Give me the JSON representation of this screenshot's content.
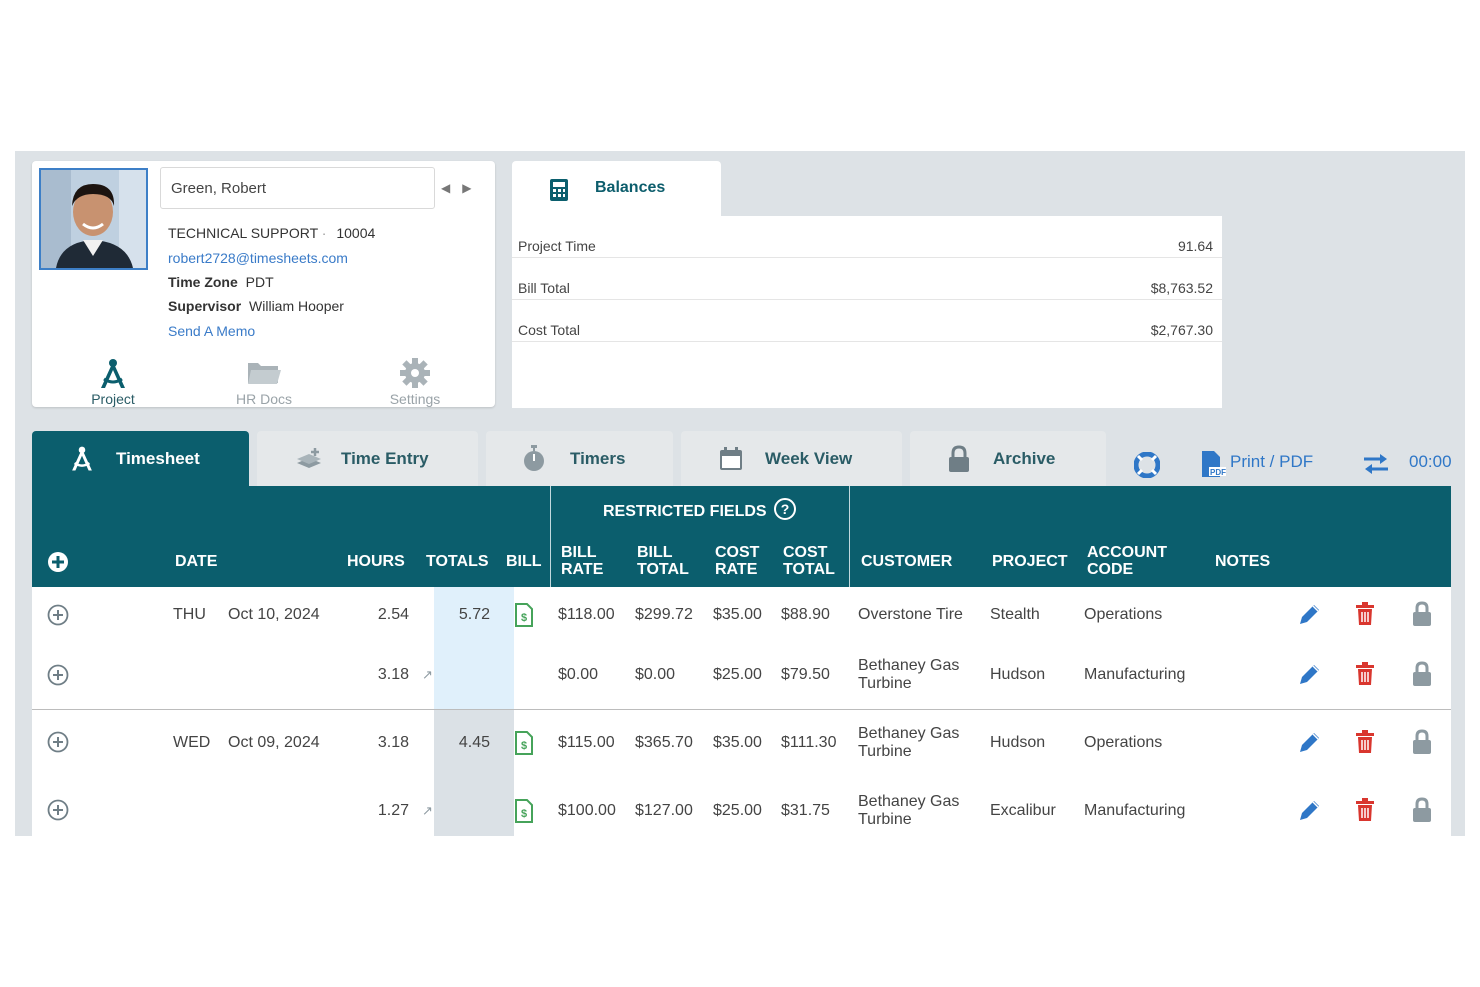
{
  "colors": {
    "primary": "#0b5e6d",
    "link": "#3a7bc8",
    "edit": "#2f77c7",
    "delete": "#d9362e",
    "lock": "#8d9aa1",
    "bill_icon": "#46a35a"
  },
  "profile": {
    "name": "Green, Robert",
    "department": "TECHNICAL SUPPORT",
    "separator": "·",
    "employee_id": "10004",
    "email": "robert2728@timesheets.com",
    "timezone_label": "Time Zone",
    "timezone": "PDT",
    "supervisor_label": "Supervisor",
    "supervisor": "William Hooper",
    "memo_link": "Send A Memo",
    "tabs": [
      {
        "label": "Project",
        "icon": "compass-icon"
      },
      {
        "label": "HR Docs",
        "icon": "folder-icon"
      },
      {
        "label": "Settings",
        "icon": "gear-icon"
      }
    ]
  },
  "balances": {
    "title": "Balances",
    "icon": "calculator-icon",
    "rows": [
      {
        "label": "Project Time",
        "value": "91.64"
      },
      {
        "label": "Bill Total",
        "value": "$8,763.52"
      },
      {
        "label": "Cost Total",
        "value": "$2,767.30"
      }
    ]
  },
  "tabs": [
    {
      "label": "Timesheet",
      "icon": "compass-icon",
      "active": true
    },
    {
      "label": "Time Entry",
      "icon": "stack-add-icon"
    },
    {
      "label": "Timers",
      "icon": "stopwatch-icon"
    },
    {
      "label": "Week View",
      "icon": "calendar-icon"
    },
    {
      "label": "Archive",
      "icon": "lock-icon"
    }
  ],
  "toolbar": {
    "help_icon": "lifebuoy-icon",
    "print_label": "Print / PDF",
    "timer_value": "00:00"
  },
  "table": {
    "restricted_label": "RESTRICTED FIELDS",
    "headers": {
      "date": "DATE",
      "hours": "HOURS",
      "totals": "TOTALS",
      "bill": "BILL",
      "bill_rate_1": "BILL",
      "bill_rate_2": "RATE",
      "bill_total_1": "BILL",
      "bill_total_2": "TOTAL",
      "cost_rate_1": "COST",
      "cost_rate_2": "RATE",
      "cost_total_1": "COST",
      "cost_total_2": "TOTAL",
      "customer": "CUSTOMER",
      "project": "PROJECT",
      "account_1": "ACCOUNT",
      "account_2": "CODE",
      "notes": "NOTES"
    },
    "rows": [
      {
        "day": "THU",
        "date": "Oct 10, 2024",
        "hours": "2.54",
        "total": "5.72",
        "billable": true,
        "bill_rate": "$118.00",
        "bill_total": "$299.72",
        "cost_rate": "$35.00",
        "cost_total": "$88.90",
        "customer_1": "Overstone Tire",
        "customer_2": "",
        "project": "Stealth",
        "account": "Operations"
      },
      {
        "day": "",
        "date": "",
        "hours": "3.18",
        "total": "",
        "billable": false,
        "bill_rate": "$0.00",
        "bill_total": "$0.00",
        "cost_rate": "$25.00",
        "cost_total": "$79.50",
        "customer_1": "Bethaney Gas",
        "customer_2": "Turbine",
        "project": "Hudson",
        "account": "Manufacturing"
      },
      {
        "day": "WED",
        "date": "Oct 09, 2024",
        "hours": "3.18",
        "total": "4.45",
        "billable": true,
        "bill_rate": "$115.00",
        "bill_total": "$365.70",
        "cost_rate": "$35.00",
        "cost_total": "$111.30",
        "customer_1": "Bethaney Gas",
        "customer_2": "Turbine",
        "project": "Hudson",
        "account": "Operations"
      },
      {
        "day": "",
        "date": "",
        "hours": "1.27",
        "total": "",
        "billable": true,
        "bill_rate": "$100.00",
        "bill_total": "$127.00",
        "cost_rate": "$25.00",
        "cost_total": "$31.75",
        "customer_1": "Bethaney Gas",
        "customer_2": "Turbine",
        "project": "Excalibur",
        "account": "Manufacturing"
      }
    ]
  }
}
